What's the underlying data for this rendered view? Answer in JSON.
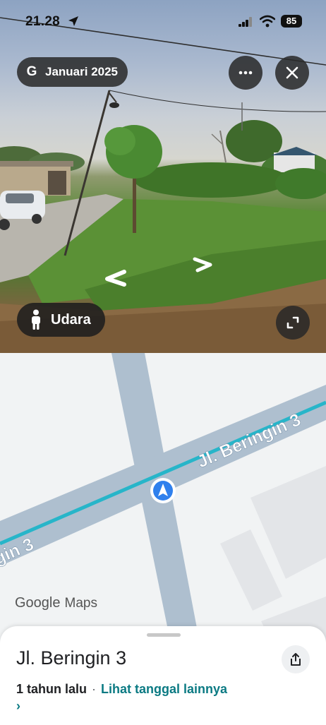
{
  "status_bar": {
    "time": "21.28",
    "battery": "85"
  },
  "street_view": {
    "date_label": "Januari 2025",
    "google_glyph": "G",
    "air_view_label": "Udara",
    "icons": {
      "more": "more-horizontal-icon",
      "close": "close-icon",
      "person": "pegman-icon",
      "expand": "expand-icon",
      "nav_left": "chevron-left-icon",
      "nav_right": "chevron-right-icon"
    }
  },
  "map": {
    "road_label_right": "Jl. Beringin 3",
    "road_label_left": "gin 3",
    "logo_google": "Google",
    "logo_maps": "Maps",
    "accent_route": "#27b5c9",
    "road_color": "#aebfcf"
  },
  "place_sheet": {
    "title": "Jl. Beringin 3",
    "time_ago": "1 tahun lalu",
    "separator": "·",
    "see_other_dates": "Lihat tanggal lainnya",
    "chevron": "›",
    "share_icon": "share-icon"
  }
}
